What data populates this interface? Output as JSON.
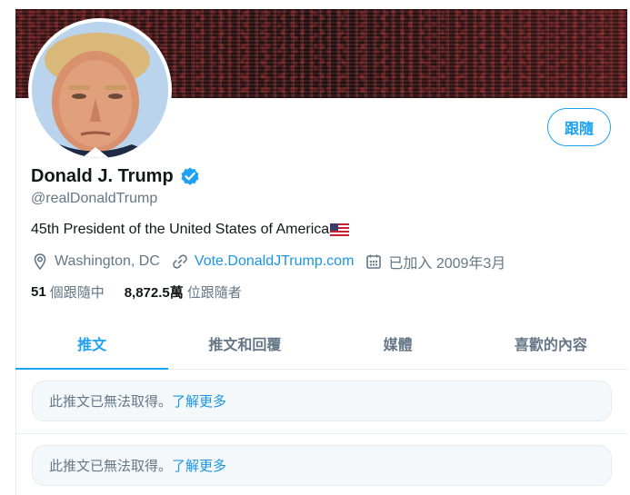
{
  "profile": {
    "display_name": "Donald J. Trump",
    "handle": "@realDonaldTrump",
    "bio": "45th President of the United States of America",
    "verified": true,
    "location": "Washington, DC",
    "website": "Vote.DonaldJTrump.com",
    "joined": "已加入 2009年3月",
    "icons": {
      "location": "location-pin-icon",
      "website": "link-icon",
      "joined": "calendar-icon",
      "verified": "verified-badge-icon",
      "bio_flag": "us-flag-emoji"
    }
  },
  "follow_button": {
    "label": "跟隨"
  },
  "stats": {
    "following_count": "51",
    "following_label": "個跟隨中",
    "followers_count": "8,872.5萬",
    "followers_label": "位跟隨者"
  },
  "tabs": [
    {
      "label": "推文",
      "active": true
    },
    {
      "label": "推文和回覆",
      "active": false
    },
    {
      "label": "媒體",
      "active": false
    },
    {
      "label": "喜歡的內容",
      "active": false
    }
  ],
  "timeline": [
    {
      "message": "此推文已無法取得。",
      "link": "了解更多"
    },
    {
      "message": "此推文已無法取得。",
      "link": "了解更多"
    }
  ],
  "colors": {
    "accent": "#1da1f2",
    "link": "#1b95e0",
    "secondary_text": "#657786",
    "primary_text": "#14171a",
    "border": "#e6ecf0"
  }
}
